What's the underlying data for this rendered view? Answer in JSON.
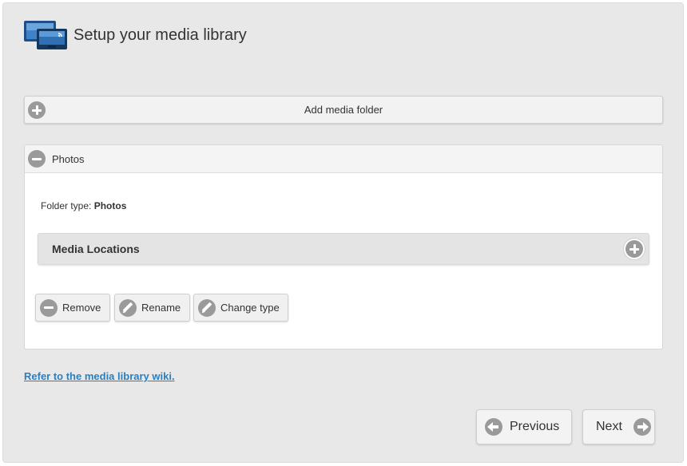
{
  "header": {
    "title": "Setup your media library",
    "icon": "media-library-icon"
  },
  "add_folder": {
    "label": "Add media folder",
    "icon": "plus-circle-icon"
  },
  "folder": {
    "name": "Photos",
    "collapse_icon": "minus-circle-icon",
    "type_label": "Folder type: ",
    "type_value": "Photos",
    "media_locations_label": "Media Locations",
    "actions": {
      "remove": "Remove",
      "rename": "Rename",
      "change_type": "Change type"
    }
  },
  "wiki_link": "Refer to the media library wiki.",
  "nav": {
    "previous": "Previous",
    "next": "Next"
  },
  "colors": {
    "background": "#e8e8e8",
    "panel": "#ffffff",
    "icon_gray": "#9a9a9a",
    "link": "#2a7fc0",
    "brand_blue": "#1f4f8a"
  }
}
